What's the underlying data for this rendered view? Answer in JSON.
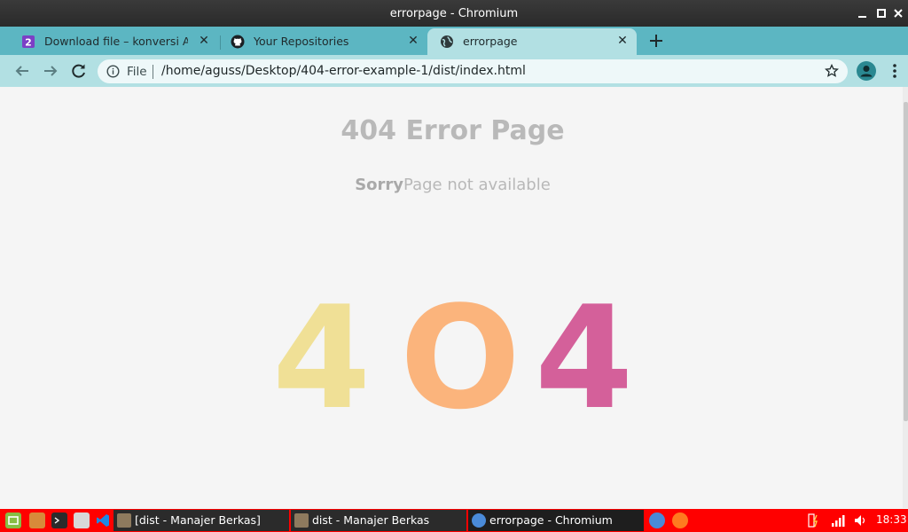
{
  "window": {
    "title": "errorpage - Chromium"
  },
  "tabs": [
    {
      "label": "Download file – konversi Anda t",
      "favicon": "number-2-icon",
      "active": false
    },
    {
      "label": "Your Repositories",
      "favicon": "github-icon",
      "active": false
    },
    {
      "label": "errorpage",
      "favicon": "globe-icon",
      "active": true
    }
  ],
  "omnibox": {
    "scheme": "File",
    "url": "/home/aguss/Desktop/404-error-example-1/dist/index.html"
  },
  "page": {
    "heading": "404 Error Page",
    "sub_bold": "Sorry",
    "sub_rest": "Page not available",
    "digits": [
      {
        "char": "4",
        "color": "#f0e096"
      },
      {
        "char": "O",
        "color": "#fbb47c"
      },
      {
        "char": "4",
        "color": "#d4609a"
      }
    ]
  },
  "taskbar": {
    "tasks": [
      {
        "label": "[dist - Manajer Berkas]"
      },
      {
        "label": "dist - Manajer Berkas"
      },
      {
        "label": "errorpage - Chromium"
      }
    ],
    "clock": "18:33"
  },
  "colors": {
    "tabstrip": "#5cb6c2",
    "toolbar": "#b2e0e3",
    "taskbar": "#ff0000"
  }
}
